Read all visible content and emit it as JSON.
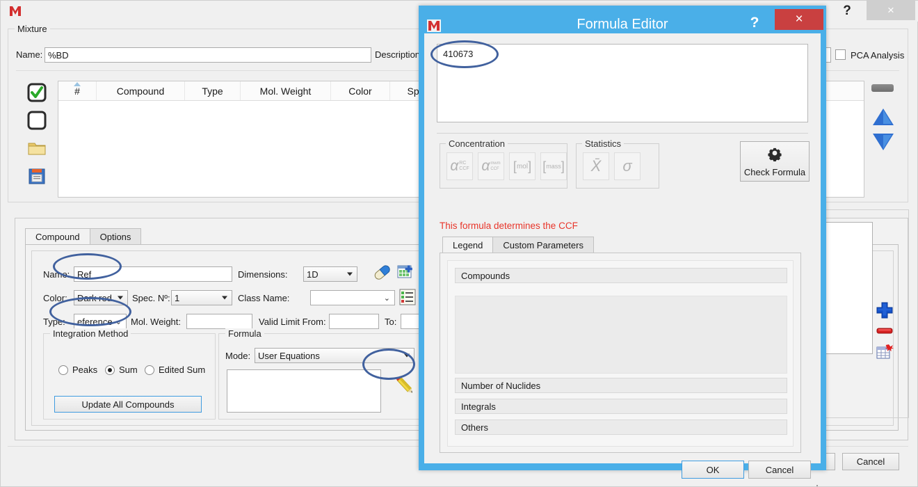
{
  "background_window": {
    "app_icon": "mnova-app-icon",
    "help_label": "?",
    "close_label": "×",
    "mixture_group_title": "Mixture",
    "name_label": "Name:",
    "name_value": "%BD",
    "description_label": "Description:",
    "description_value": "",
    "pca_label": "PCA Analysis",
    "side_icons": [
      {
        "name": "check-all-icon",
        "glyph": "✔"
      },
      {
        "name": "uncheck-all-icon",
        "glyph": ""
      },
      {
        "name": "open-folder-icon",
        "glyph": ""
      },
      {
        "name": "save-icon",
        "glyph": ""
      }
    ],
    "table": {
      "columns": [
        "#",
        "Compound",
        "Type",
        "Mol. Weight",
        "Color",
        "Spectrum"
      ],
      "rows": []
    },
    "right_icons": [
      {
        "name": "grip-handle-icon"
      },
      {
        "name": "move-up-icon"
      },
      {
        "name": "move-down-icon"
      }
    ],
    "right_panel_icons": [
      {
        "name": "add-row-icon"
      },
      {
        "name": "remove-row-icon"
      },
      {
        "name": "delete-table-icon"
      }
    ],
    "cancel_label": "Cancel",
    "compound_panel": {
      "tabs": [
        {
          "label": "Compound",
          "active": true
        },
        {
          "label": "Options",
          "active": false
        }
      ],
      "name_label": "Name:",
      "name_value": "Ref",
      "dimensions_label": "Dimensions:",
      "dimensions_value": "1D",
      "color_label": "Color:",
      "color_value": "Dark red",
      "spec_no_label": "Spec. Nº:",
      "spec_no_value": "1",
      "class_name_label": "Class Name:",
      "class_name_value": "",
      "type_label": "Type:",
      "type_value": "eference",
      "mol_weight_label": "Mol. Weight:",
      "mol_weight_value": "",
      "valid_limit_from_label": "Valid Limit From:",
      "valid_limit_from_value": "",
      "valid_limit_to_label": "To:",
      "valid_limit_to_value": "",
      "eraser_icon": "pill-eraser-icon",
      "table_add_icon": "table-add-icon",
      "class_list_icon": "class-list-icon",
      "integration_group_title": "Integration Method",
      "integration_options": [
        {
          "label": "Peaks",
          "selected": false
        },
        {
          "label": "Sum",
          "selected": true
        },
        {
          "label": "Edited Sum",
          "selected": false
        }
      ],
      "update_button_label": "Update All Compounds",
      "formula_group_title": "Formula",
      "mode_label": "Mode:",
      "mode_value": "User Equations",
      "formula_text": "",
      "edit_pencil_icon": "pencil-edit-icon"
    }
  },
  "dialog": {
    "app_icon": "mnova-app-icon",
    "title": "Formula Editor",
    "help_label": "?",
    "close_label": "×",
    "formula_value": "410673",
    "concentration_group_title": "Concentration",
    "concentration_buttons": [
      {
        "name": "alpha-rc-ccf-icon",
        "main": "α",
        "sup": "RC",
        "sub": "CCF"
      },
      {
        "name": "alpha-mwm-ccf-icon",
        "main": "α",
        "sup": "mwm",
        "sub": "CCF"
      },
      {
        "name": "mol-bracket-icon",
        "main": "mol",
        "sup": "",
        "sub": ""
      },
      {
        "name": "mass-bracket-icon",
        "main": "mass",
        "sup": "",
        "sub": ""
      }
    ],
    "statistics_group_title": "Statistics",
    "statistics_buttons": [
      {
        "name": "mean-x-bar-icon",
        "main": "X̄"
      },
      {
        "name": "sigma-icon",
        "main": "σ"
      }
    ],
    "check_formula_label": "Check Formula",
    "check_formula_icon": "gear-icon",
    "ccf_message": "This formula determines the CCF",
    "ccf_message_color": "#e8352a",
    "tabs": [
      {
        "label": "Legend",
        "active": true
      },
      {
        "label": "Custom Parameters",
        "active": false
      }
    ],
    "legend_sections": [
      {
        "label": "Compounds",
        "expanded": true
      },
      {
        "label": "Number of Nuclides",
        "expanded": false
      },
      {
        "label": "Integrals",
        "expanded": false
      },
      {
        "label": "Others",
        "expanded": false
      }
    ],
    "ok_label": "OK",
    "cancel_label": "Cancel",
    "title_bar_color": "#4aafe8",
    "close_button_color": "#c94040"
  },
  "annotations": {
    "ellipse_color": "#41619e",
    "highlights": [
      "formula-input-field",
      "compound-name-field",
      "compound-type-dropdown",
      "formula-edit-pencil"
    ]
  }
}
